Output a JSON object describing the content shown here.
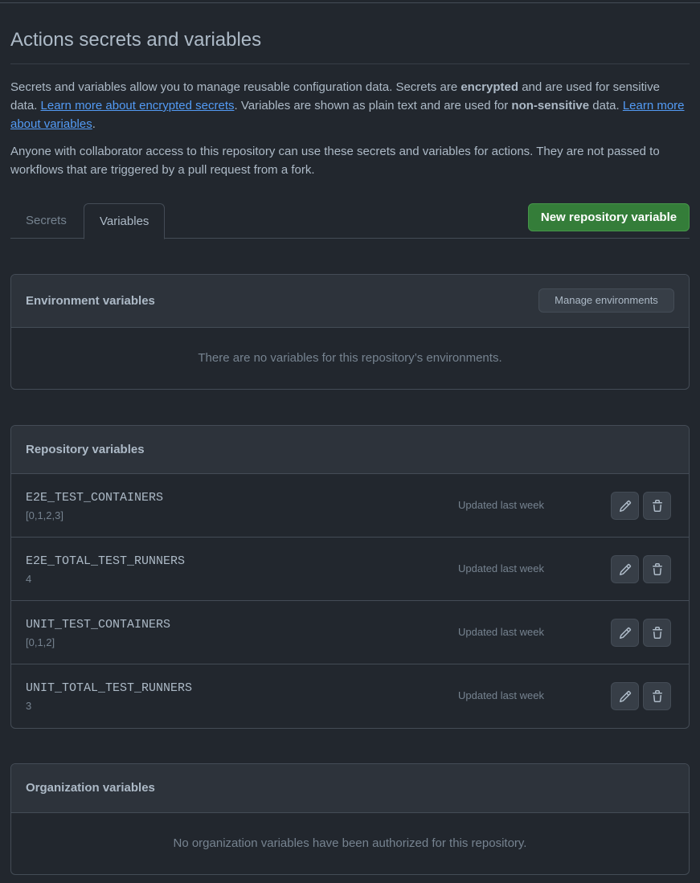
{
  "page": {
    "title": "Actions secrets and variables",
    "desc": {
      "p1_a": "Secrets and variables allow you to manage reusable configuration data. Secrets are ",
      "p1_b": "encrypted",
      "p1_c": " and are used for sensitive data. ",
      "link_secrets": "Learn more about encrypted secrets",
      "p1_d": ". Variables are shown as plain text and are used for ",
      "p1_e": "non-sensitive",
      "p1_f": " data. ",
      "link_variables": "Learn more about variables",
      "p1_g": ".",
      "p2": "Anyone with collaborator access to this repository can use these secrets and variables for actions. They are not passed to workflows that are triggered by a pull request from a fork."
    }
  },
  "tabs": [
    {
      "label": "Secrets",
      "active": false
    },
    {
      "label": "Variables",
      "active": true
    }
  ],
  "new_variable_button": "New repository variable",
  "environment": {
    "heading": "Environment variables",
    "manage_button": "Manage environments",
    "empty_text": "There are no variables for this repository’s environments."
  },
  "repository": {
    "heading": "Repository variables",
    "variables": [
      {
        "name": "E2E_TEST_CONTAINERS",
        "value": "[0,1,2,3]",
        "updated": "Updated last week"
      },
      {
        "name": "E2E_TOTAL_TEST_RUNNERS",
        "value": "4",
        "updated": "Updated last week"
      },
      {
        "name": "UNIT_TEST_CONTAINERS",
        "value": "[0,1,2]",
        "updated": "Updated last week"
      },
      {
        "name": "UNIT_TOTAL_TEST_RUNNERS",
        "value": "3",
        "updated": "Updated last week"
      }
    ]
  },
  "organization": {
    "heading": "Organization variables",
    "empty_text": "No organization variables have been authorized for this repository."
  },
  "icons": {
    "edit": "pencil-icon",
    "delete": "trash-icon"
  },
  "colors": {
    "background": "#22272e",
    "header_bg": "#2d333b",
    "border": "#444c56",
    "primary_button": "#347d39",
    "link": "#539bf5",
    "text": "#adbac7",
    "muted": "#768390"
  }
}
